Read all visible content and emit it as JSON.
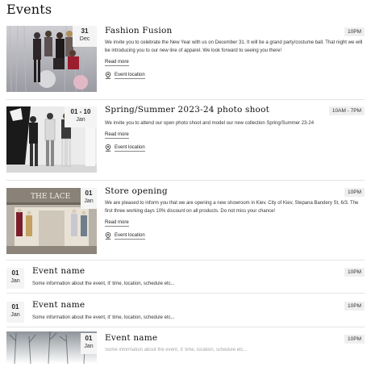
{
  "page": {
    "title": "Events"
  },
  "icons": {
    "location": "map-pin-icon"
  },
  "colors": {
    "badge_bg": "#efefef",
    "date_bg": "#f4f4f4",
    "separator": "#e4e4e4"
  },
  "events": [
    {
      "title": "Fashion Fusion",
      "time": "10PM",
      "day": "31",
      "month": "Dec",
      "description": "We invite you to celebrate the New Year with us on December 31. It will be a grand party/costume ball. That night we will be introducing you to our new line of apparel. We look forward to seeing you there!",
      "read_more": "Read more",
      "location": "Event location"
    },
    {
      "title": "Spring/Summer 2023-24 photo shoot",
      "time": "10AM - 7PM",
      "day": "01 - 10",
      "month": "Jan",
      "description": "We invite you to attend our open photo shoot and model our new collection Spring/Summer 23-24",
      "read_more": "Read more",
      "location": "Event location"
    },
    {
      "title": "Store opening",
      "time": "10PM",
      "day": "01",
      "month": "Jan",
      "store_sign": "THE LACE",
      "description": "We are pleased to inform you that we are opening a new showroom in Kiev. City of Kiev, Stepana Bandery St, 6/3. The first three working days 10% discount on all products. Do not miss your chance!",
      "read_more": "Read more",
      "location": "Event location"
    },
    {
      "title": "Event name",
      "time": "10PM",
      "day": "01",
      "month": "Jan",
      "description": "Some information about the event, it' time, location, schedule etc..."
    },
    {
      "title": "Event name",
      "time": "10PM",
      "day": "01",
      "month": "Jan",
      "description": "Some information about the event, it' time, location, schedule etc..."
    },
    {
      "title": "Event name",
      "time": "10PM",
      "day": "01",
      "month": "Jan",
      "description": "Some information about the event, it' time, location, schedule etc..."
    }
  ]
}
